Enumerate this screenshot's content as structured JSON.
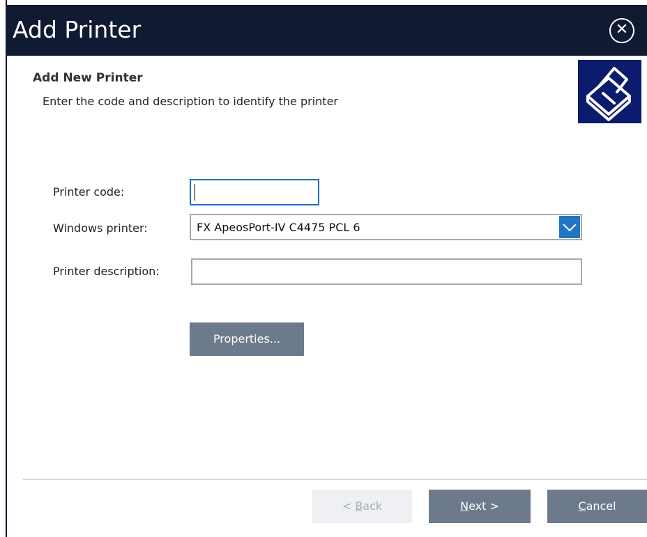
{
  "window": {
    "title": "Add Printer",
    "close_icon": "close-circle-icon"
  },
  "header": {
    "heading": "Add New Printer",
    "subheading": "Enter the code and description to identify the printer",
    "icon": "printer-icon"
  },
  "form": {
    "printer_code_label": "Printer code:",
    "printer_code_value": "",
    "windows_printer_label": "Windows printer:",
    "windows_printer_value": "FX ApeosPort-IV C4475 PCL 6",
    "printer_description_label": "Printer description:",
    "printer_description_value": "",
    "properties_button": "Properties..."
  },
  "footer": {
    "back_prefix": "< ",
    "back_mnemonic": "B",
    "back_rest": "ack",
    "next_mnemonic": "N",
    "next_rest": "ext >",
    "cancel_mnemonic": "C",
    "cancel_rest": "ancel"
  },
  "colors": {
    "titlebar": "#111a33",
    "icon_bg": "#0b1b6e",
    "button": "#6d7a8c",
    "focus": "#1e6fc2",
    "dropdown_arrow_bg": "#2176c6"
  }
}
